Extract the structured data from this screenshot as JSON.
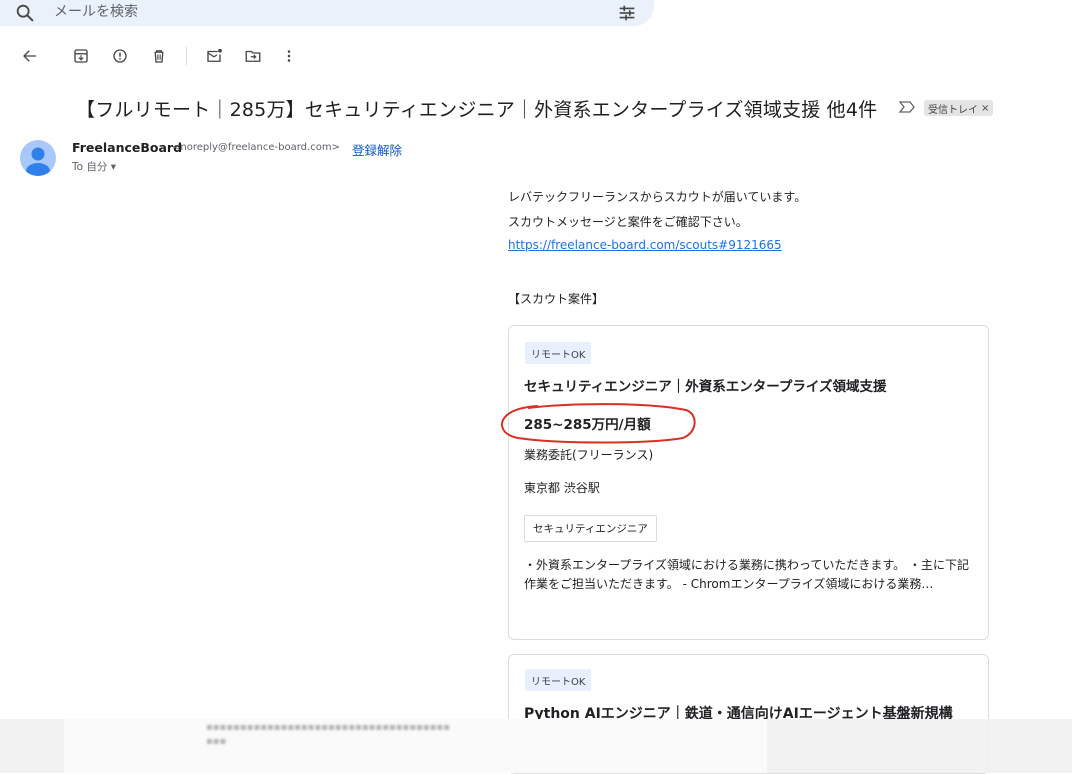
{
  "search": {
    "placeholder": "メールを検索"
  },
  "email": {
    "subject": "【フルリモート｜285万】セキュリティエンジニア｜外資系エンタープライズ領域支援 他4件",
    "label": "受信トレイ",
    "label_close": "×",
    "sender_name": "FreelanceBoard",
    "sender_email": "<noreply@freelance-board.com>",
    "unsubscribe": "登録解除",
    "to": "To 自分 ▾",
    "body_lines": [
      "レバテックフリーランスからスカウトが届いています。",
      "スカウトメッセージと案件をご確認下さい。"
    ],
    "link": "https://freelance-board.com/scouts#9121665",
    "section_title": "【スカウト案件】"
  },
  "cards": [
    {
      "badge": "リモートOK",
      "title": "セキュリティエンジニア｜外資系エンタープライズ領域支援",
      "salary": "285~285万円/月額",
      "contract": "業務委託(フリーランス)",
      "location": "東京都 渋谷駅",
      "skill": "セキュリティエンジニア",
      "desc": "・外資系エンタープライズ領域における業務に携わっていただきます。 ・主に下記作業をご担当いただきます。 - Chromエンタープライズ領域における業務…"
    },
    {
      "badge": "リモートOK",
      "title": "Python AIエンジニア｜鉄道・通信向けAIエージェント基盤新規構"
    }
  ],
  "colors": {
    "accent_link": "#1a73e8",
    "unsubscribe": "#0b57d0",
    "search_bg": "#eaf1fb",
    "annotation": "#d93025"
  },
  "icons": {
    "back": "arrow-left-icon",
    "archive": "archive-icon",
    "report": "report-spam-icon",
    "delete": "trash-icon",
    "mark_unread": "mark-unread-icon",
    "move": "move-to-icon",
    "more": "more-vert-icon"
  }
}
